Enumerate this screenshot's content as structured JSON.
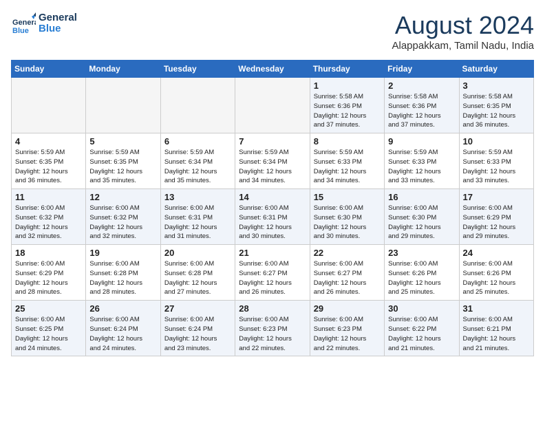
{
  "logo": {
    "line1": "General",
    "line2": "Blue"
  },
  "title": "August 2024",
  "location": "Alappakkam, Tamil Nadu, India",
  "headers": [
    "Sunday",
    "Monday",
    "Tuesday",
    "Wednesday",
    "Thursday",
    "Friday",
    "Saturday"
  ],
  "weeks": [
    [
      {
        "num": "",
        "info": "",
        "empty": true
      },
      {
        "num": "",
        "info": "",
        "empty": true
      },
      {
        "num": "",
        "info": "",
        "empty": true
      },
      {
        "num": "",
        "info": "",
        "empty": true
      },
      {
        "num": "1",
        "info": "Sunrise: 5:58 AM\nSunset: 6:36 PM\nDaylight: 12 hours\nand 37 minutes."
      },
      {
        "num": "2",
        "info": "Sunrise: 5:58 AM\nSunset: 6:36 PM\nDaylight: 12 hours\nand 37 minutes."
      },
      {
        "num": "3",
        "info": "Sunrise: 5:58 AM\nSunset: 6:35 PM\nDaylight: 12 hours\nand 36 minutes."
      }
    ],
    [
      {
        "num": "4",
        "info": "Sunrise: 5:59 AM\nSunset: 6:35 PM\nDaylight: 12 hours\nand 36 minutes."
      },
      {
        "num": "5",
        "info": "Sunrise: 5:59 AM\nSunset: 6:35 PM\nDaylight: 12 hours\nand 35 minutes."
      },
      {
        "num": "6",
        "info": "Sunrise: 5:59 AM\nSunset: 6:34 PM\nDaylight: 12 hours\nand 35 minutes."
      },
      {
        "num": "7",
        "info": "Sunrise: 5:59 AM\nSunset: 6:34 PM\nDaylight: 12 hours\nand 34 minutes."
      },
      {
        "num": "8",
        "info": "Sunrise: 5:59 AM\nSunset: 6:33 PM\nDaylight: 12 hours\nand 34 minutes."
      },
      {
        "num": "9",
        "info": "Sunrise: 5:59 AM\nSunset: 6:33 PM\nDaylight: 12 hours\nand 33 minutes."
      },
      {
        "num": "10",
        "info": "Sunrise: 5:59 AM\nSunset: 6:33 PM\nDaylight: 12 hours\nand 33 minutes."
      }
    ],
    [
      {
        "num": "11",
        "info": "Sunrise: 6:00 AM\nSunset: 6:32 PM\nDaylight: 12 hours\nand 32 minutes."
      },
      {
        "num": "12",
        "info": "Sunrise: 6:00 AM\nSunset: 6:32 PM\nDaylight: 12 hours\nand 32 minutes."
      },
      {
        "num": "13",
        "info": "Sunrise: 6:00 AM\nSunset: 6:31 PM\nDaylight: 12 hours\nand 31 minutes."
      },
      {
        "num": "14",
        "info": "Sunrise: 6:00 AM\nSunset: 6:31 PM\nDaylight: 12 hours\nand 30 minutes."
      },
      {
        "num": "15",
        "info": "Sunrise: 6:00 AM\nSunset: 6:30 PM\nDaylight: 12 hours\nand 30 minutes."
      },
      {
        "num": "16",
        "info": "Sunrise: 6:00 AM\nSunset: 6:30 PM\nDaylight: 12 hours\nand 29 minutes."
      },
      {
        "num": "17",
        "info": "Sunrise: 6:00 AM\nSunset: 6:29 PM\nDaylight: 12 hours\nand 29 minutes."
      }
    ],
    [
      {
        "num": "18",
        "info": "Sunrise: 6:00 AM\nSunset: 6:29 PM\nDaylight: 12 hours\nand 28 minutes."
      },
      {
        "num": "19",
        "info": "Sunrise: 6:00 AM\nSunset: 6:28 PM\nDaylight: 12 hours\nand 28 minutes."
      },
      {
        "num": "20",
        "info": "Sunrise: 6:00 AM\nSunset: 6:28 PM\nDaylight: 12 hours\nand 27 minutes."
      },
      {
        "num": "21",
        "info": "Sunrise: 6:00 AM\nSunset: 6:27 PM\nDaylight: 12 hours\nand 26 minutes."
      },
      {
        "num": "22",
        "info": "Sunrise: 6:00 AM\nSunset: 6:27 PM\nDaylight: 12 hours\nand 26 minutes."
      },
      {
        "num": "23",
        "info": "Sunrise: 6:00 AM\nSunset: 6:26 PM\nDaylight: 12 hours\nand 25 minutes."
      },
      {
        "num": "24",
        "info": "Sunrise: 6:00 AM\nSunset: 6:26 PM\nDaylight: 12 hours\nand 25 minutes."
      }
    ],
    [
      {
        "num": "25",
        "info": "Sunrise: 6:00 AM\nSunset: 6:25 PM\nDaylight: 12 hours\nand 24 minutes."
      },
      {
        "num": "26",
        "info": "Sunrise: 6:00 AM\nSunset: 6:24 PM\nDaylight: 12 hours\nand 24 minutes."
      },
      {
        "num": "27",
        "info": "Sunrise: 6:00 AM\nSunset: 6:24 PM\nDaylight: 12 hours\nand 23 minutes."
      },
      {
        "num": "28",
        "info": "Sunrise: 6:00 AM\nSunset: 6:23 PM\nDaylight: 12 hours\nand 22 minutes."
      },
      {
        "num": "29",
        "info": "Sunrise: 6:00 AM\nSunset: 6:23 PM\nDaylight: 12 hours\nand 22 minutes."
      },
      {
        "num": "30",
        "info": "Sunrise: 6:00 AM\nSunset: 6:22 PM\nDaylight: 12 hours\nand 21 minutes."
      },
      {
        "num": "31",
        "info": "Sunrise: 6:00 AM\nSunset: 6:21 PM\nDaylight: 12 hours\nand 21 minutes."
      }
    ]
  ]
}
